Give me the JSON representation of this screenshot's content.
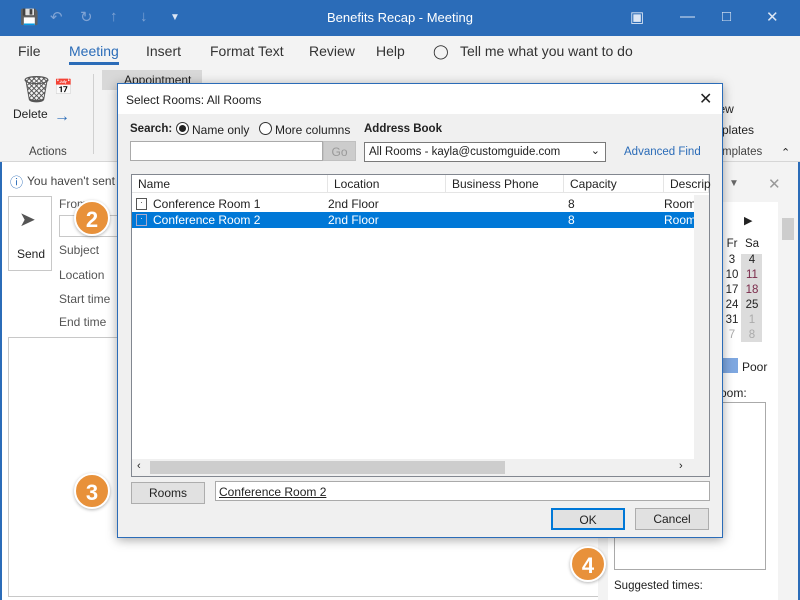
{
  "window": {
    "title": "Benefits Recap  -  Meeting"
  },
  "menu": [
    "File",
    "Meeting",
    "Insert",
    "Format Text",
    "Review",
    "Help"
  ],
  "tell_me": "Tell me what you want to do",
  "ribbon": {
    "delete": "Delete",
    "actions": "Actions",
    "appointment": "Appointment",
    "view": "View",
    "templates_line": "plates",
    "templates_group": "mplates"
  },
  "form": {
    "info": "You haven't sent t",
    "send": "Send",
    "from": "From",
    "subject": "Subject",
    "location": "Location",
    "start": "Start time",
    "end": "End time"
  },
  "side": {
    "days": [
      "Fr",
      "Sa"
    ],
    "fr": [
      "3",
      "10",
      "17",
      "24",
      "31",
      "7"
    ],
    "sa": [
      "4",
      "11",
      "18",
      "25",
      "1",
      "8"
    ],
    "poor": "Poor",
    "room": "room:",
    "suggested": "Suggested times:",
    "poor_color": "#7ea7e0"
  },
  "dialog": {
    "title": "Select Rooms: All Rooms",
    "search_label": "Search:",
    "name_only": "Name only",
    "more_columns": "More columns",
    "address_book_label": "Address Book",
    "address_book_value": "All Rooms - kayla@customguide.com",
    "go": "Go",
    "advanced_find": "Advanced Find",
    "search_value": "",
    "columns": [
      "Name",
      "Location",
      "Business Phone",
      "Capacity",
      "Descrip"
    ],
    "rows": [
      {
        "name": "Conference Room 1",
        "location": "2nd Floor",
        "phone": "",
        "capacity": "8",
        "desc": "Room"
      },
      {
        "name": "Conference Room 2",
        "location": "2nd Floor",
        "phone": "",
        "capacity": "8",
        "desc": "Room"
      }
    ],
    "rooms_button": "Rooms",
    "rooms_value": "Conference Room 2",
    "ok": "OK",
    "cancel": "Cancel"
  },
  "callouts": [
    "2",
    "3",
    "4"
  ],
  "colors": {
    "accent": "#2b6cb8",
    "selection": "#0078d7",
    "callout": "#e8913a"
  }
}
